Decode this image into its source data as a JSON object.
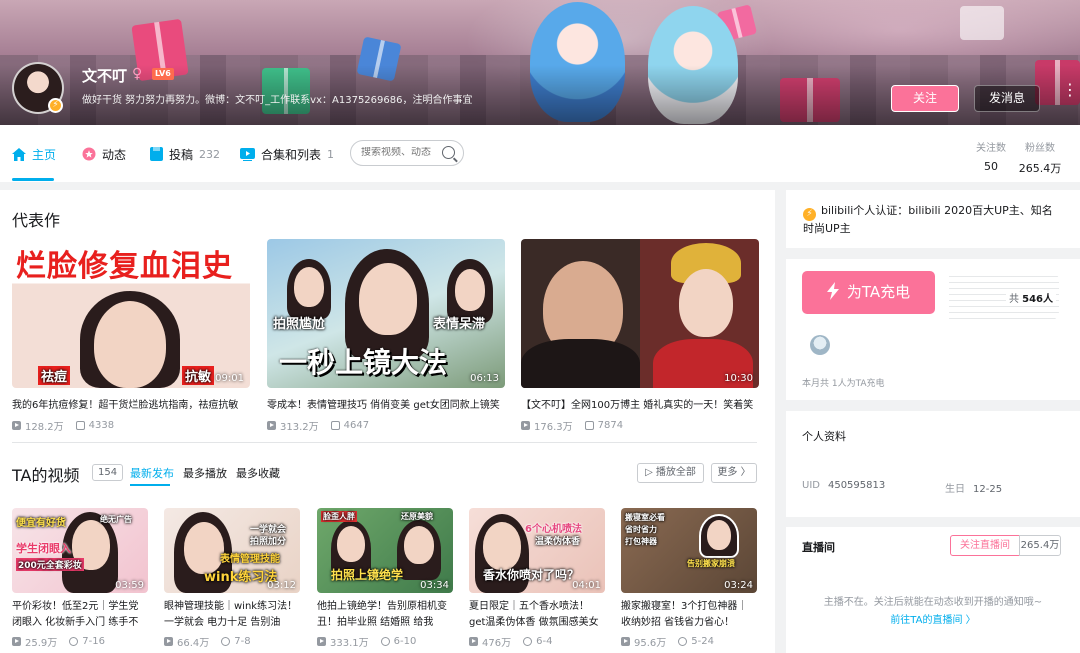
{
  "profile": {
    "name": "文不叮",
    "gender_symbol": "♀",
    "level": "LV6",
    "signature": "做好干货 努力努力再努力。微博：文不叮_工作联系vx：A1375269686，注明合作事宜",
    "follow_label": "关注",
    "message_label": "发消息",
    "more_symbol": "⋮",
    "verified_symbol": "⚡"
  },
  "nav": {
    "items": [
      {
        "label": "主页",
        "count": ""
      },
      {
        "label": "动态",
        "count": ""
      },
      {
        "label": "投稿",
        "count": "232"
      },
      {
        "label": "合集和列表",
        "count": "1"
      }
    ],
    "search_placeholder": "搜索视频、动态",
    "stats": [
      {
        "label": "关注数",
        "value": "50"
      },
      {
        "label": "粉丝数",
        "value": "265.4万"
      }
    ]
  },
  "featured": {
    "title": "代表作",
    "videos": [
      {
        "title": "我的6年抗痘修复！超干货烂脸逃坑指南，祛痘抗敏",
        "duration": "09:01",
        "views": "128.2万",
        "danmaku": "4338",
        "caption_main": "烂脸修复血泪史",
        "caption_a": "祛痘",
        "caption_b": "抗敏"
      },
      {
        "title": "零成本！表情管理技巧 俏俏变美 get女团同款上镜笑",
        "duration": "06:13",
        "views": "313.2万",
        "danmaku": "4647",
        "caption_main": "一秒上镜大法",
        "caption_a": "拍照尴尬",
        "caption_b": "表情呆滞"
      },
      {
        "title": "【文不叮】全网100万博主 婚礼真实的一天！笑着笑",
        "duration": "10:30",
        "views": "176.3万",
        "danmaku": "7874"
      }
    ]
  },
  "videos": {
    "title": "TA的视频",
    "count": "154",
    "tabs": [
      "最新发布",
      "最多播放",
      "最多收藏"
    ],
    "play_all_label": "▷ 播放全部",
    "more_label": "更多 〉",
    "items": [
      {
        "title": "平价彩妆！低至2元｜学生党闭眼入 化妆新手入门 练手不",
        "duration": "03:59",
        "views": "25.9万",
        "date": "7-16",
        "cap1": "便宜有好货",
        "cap2": "学生闭眼入",
        "cap3": "200元全套彩妆",
        "cap4": "绝无广告"
      },
      {
        "title": "眼神管理技能｜wink练习法！一学就会 电力十足 告别油",
        "duration": "03:12",
        "views": "66.4万",
        "date": "7-8",
        "cap1": "一学就会",
        "cap2": "拍照加分",
        "cap3": "表情管理技能",
        "cap4": "wink练习法"
      },
      {
        "title": "他拍上镜绝学！告别原相机变丑！拍毕业照 结婚照 给我",
        "duration": "03:34",
        "views": "333.1万",
        "date": "6-10",
        "cap1": "脸歪人胖",
        "cap2": "还原美貌",
        "cap3": "拍照上镜绝学"
      },
      {
        "title": "夏日限定｜五个香水喷法！get温柔伪体香 做氛围感美女",
        "duration": "04:01",
        "views": "476万",
        "date": "6-4",
        "cap1": "6个心机喷法",
        "cap2": "温柔伪体香",
        "cap3": "香水你喷对了吗？"
      },
      {
        "title": "搬家搬寝室！3个打包神器｜收纳妙招 省钱省力省心！",
        "duration": "03:24",
        "views": "95.6万",
        "date": "5-24",
        "cap1": "搬寝室必看",
        "cap2": "省时省力",
        "cap3": "打包神器",
        "cap4": "告别搬家崩溃"
      }
    ]
  },
  "side": {
    "certification": "bilibili个人认证：bilibili 2020百大UP主、知名时尚UP主",
    "charge_label": "为TA充电",
    "charge_total_prefix": "共",
    "charge_total": "546人",
    "charge_note": "本月共 1人为TA充电",
    "profile_title": "个人资料",
    "uid_label": "UID",
    "uid": "450595813",
    "birthday_label": "生日",
    "birthday": "12-25",
    "live_title": "直播间",
    "live_follow": "关注直播间",
    "live_count": "265.4万",
    "live_tip": "主播不在。关注后就能在动态收到开播的通知哦~",
    "live_go": "前往TA的直播间 〉"
  },
  "colors": {
    "accent": "#00aeec",
    "pink": "#fb7299"
  }
}
